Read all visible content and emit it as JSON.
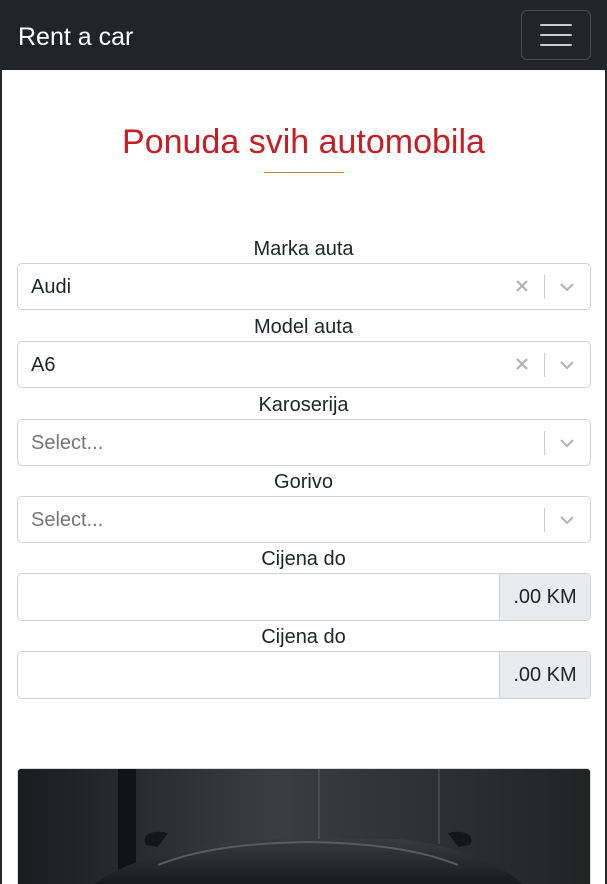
{
  "navbar": {
    "brand": "Rent a car",
    "menu_icon": "hamburger-icon"
  },
  "main": {
    "title": "Ponuda svih automobila",
    "colors": {
      "title": "#c31f24",
      "rule": "#d17a3b",
      "navbar": "#212529"
    }
  },
  "filters": {
    "brand": {
      "label": "Marka auta",
      "value": "Audi"
    },
    "model": {
      "label": "Model auta",
      "value": "A6"
    },
    "body": {
      "label": "Karoserija",
      "placeholder": "Select..."
    },
    "fuel": {
      "label": "Gorivo",
      "placeholder": "Select..."
    },
    "price_1": {
      "label": "Cijena do",
      "value": "",
      "suffix": ".00 KM"
    },
    "price_2": {
      "label": "Cijena do",
      "value": "",
      "suffix": ".00 KM"
    }
  },
  "car_card": {
    "image": "dark-car-photo"
  }
}
